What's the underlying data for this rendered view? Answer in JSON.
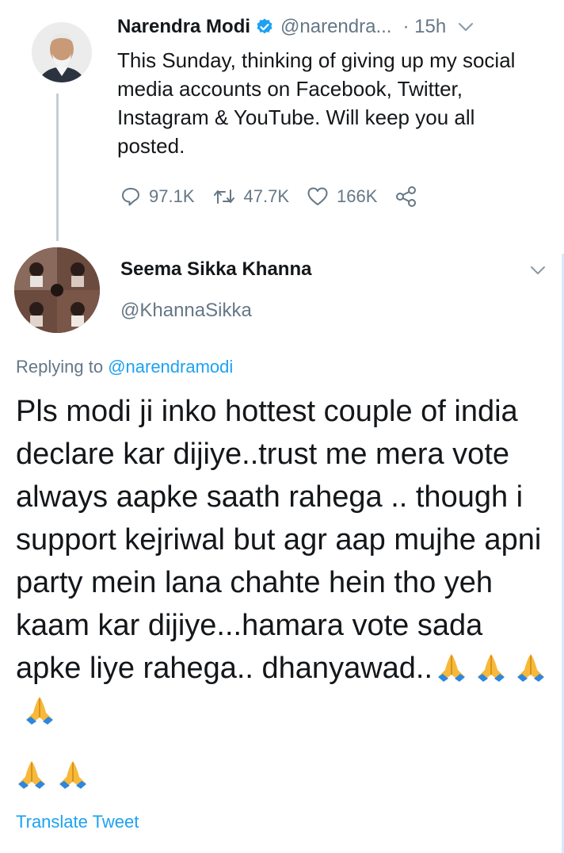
{
  "original_tweet": {
    "author_name": "Narendra Modi",
    "handle": "@narendra...",
    "time": "· 15h",
    "text": "This Sunday, thinking of giving up my social media accounts on Facebook, Twitter, Instagram & YouTube. Will keep you all posted.",
    "verified": true,
    "stats": {
      "replies": "97.1K",
      "retweets": "47.7K",
      "likes": "166K"
    }
  },
  "reply": {
    "author_name": "Seema Sikka Khanna",
    "handle": "@KhannaSikka",
    "replying_label": "Replying to ",
    "replying_to": "@narendramodi",
    "text": "Pls modi ji inko hottest couple of india declare kar dijiye..trust me mera vote always aapke saath rahega .. though i support kejriwal but agr aap mujhe apni party mein lana chahte hein tho yeh kaam kar dijiye...hamara vote sada apke liye rahega.. dhanyawad..",
    "trailing_emoji_count": 6,
    "translate_label": "Translate Tweet"
  },
  "icons": [
    "verified-badge-icon",
    "chevron-down-icon",
    "reply-icon",
    "retweet-icon",
    "like-icon",
    "share-icon",
    "folded-hands-emoji"
  ],
  "colors": {
    "accent": "#1da1f2",
    "muted": "#657786",
    "text": "#14171a"
  }
}
